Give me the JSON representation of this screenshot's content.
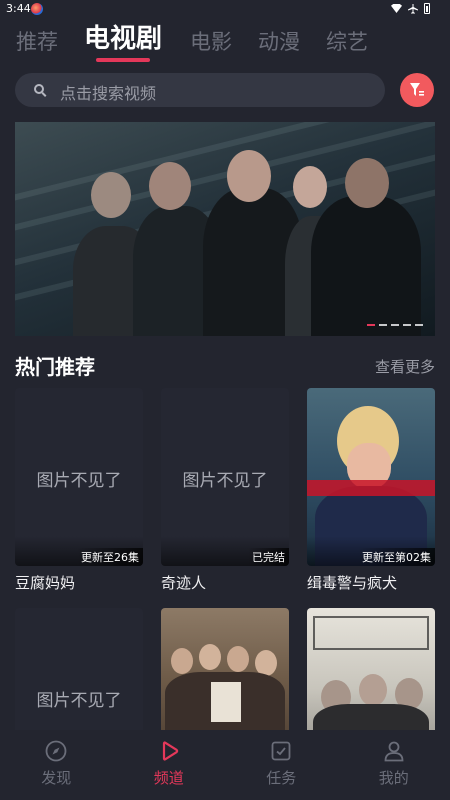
{
  "status_bar": {
    "time": "3:44"
  },
  "top_tabs": [
    "推荐",
    "电视剧",
    "电影",
    "动漫",
    "综艺"
  ],
  "active_tab": "电视剧",
  "search": {
    "placeholder": "点击搜索视频"
  },
  "section": {
    "title": "热门推荐",
    "more": "查看更多"
  },
  "cards": [
    {
      "title": "豆腐妈妈",
      "badge": "更新至26集",
      "missing_text": "图片不见了"
    },
    {
      "title": "奇迹人",
      "badge": "已完结",
      "missing_text": "图片不见了"
    },
    {
      "title": "缉毒警与疯犬",
      "badge": "更新至第02集"
    },
    {
      "missing_text": "图片不见了"
    },
    {},
    {}
  ],
  "bottom_nav": [
    {
      "label": "发现",
      "icon": "compass-icon"
    },
    {
      "label": "频道",
      "icon": "play-icon"
    },
    {
      "label": "任务",
      "icon": "task-check-icon"
    },
    {
      "label": "我的",
      "icon": "user-icon"
    }
  ],
  "active_nav": "频道",
  "colors": {
    "accent": "#e4385a",
    "background": "#23252f",
    "filter_button": "#f25a5e"
  }
}
